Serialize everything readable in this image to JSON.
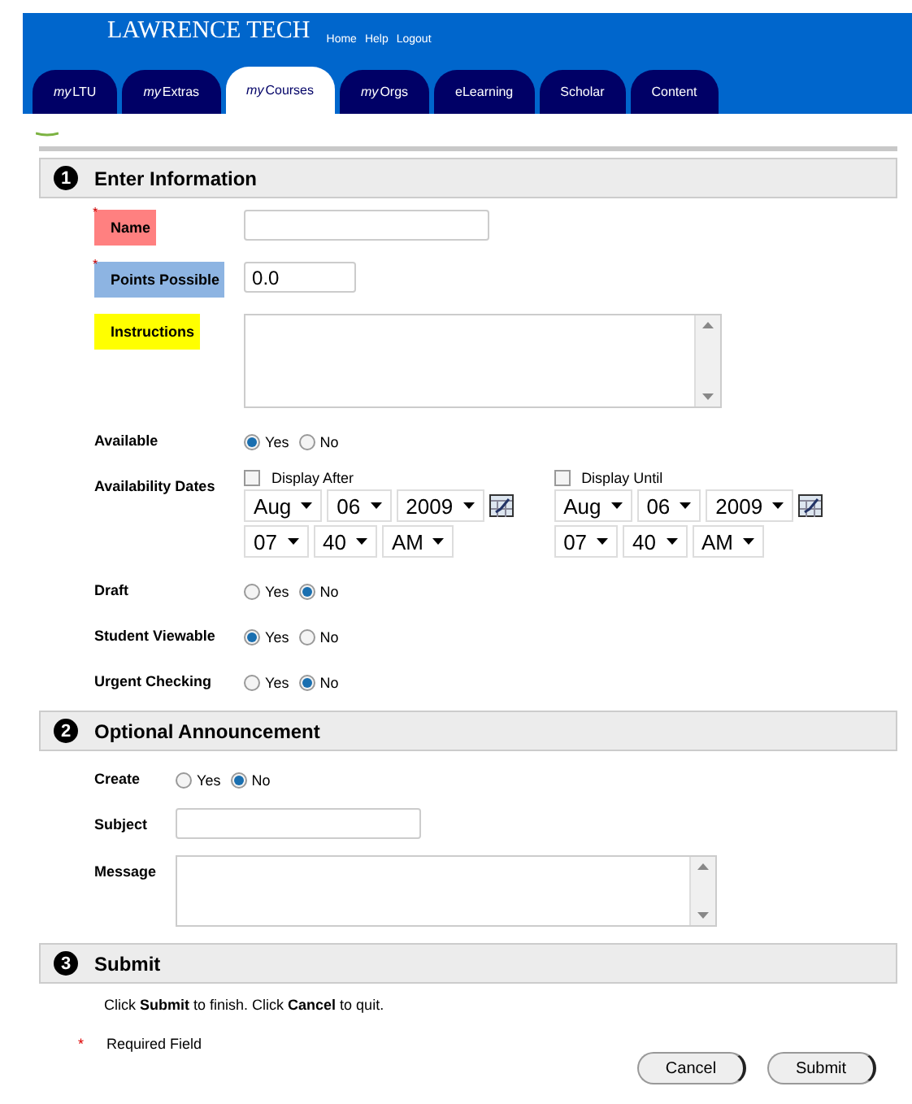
{
  "header": {
    "logo": "LAWRENCE TECH",
    "links": [
      "Home",
      "Help",
      "Logout"
    ],
    "tabs": [
      {
        "prefix": "my",
        "label": "LTU",
        "selected": false
      },
      {
        "prefix": "my",
        "label": "Extras",
        "selected": false
      },
      {
        "prefix": "my",
        "label": "Courses",
        "selected": true
      },
      {
        "prefix": "my",
        "label": "Orgs",
        "selected": false
      },
      {
        "label": "eLearning",
        "selected": false
      },
      {
        "label": "Scholar",
        "selected": false
      },
      {
        "label": "Content",
        "selected": false
      }
    ]
  },
  "sections": [
    {
      "number": "1",
      "title": "Enter Information",
      "fields": [
        {
          "kind": "text",
          "label": "Name",
          "mark": "*",
          "color": "#ff8080"
        },
        {
          "kind": "number",
          "label": "Points Possible",
          "mark": "*",
          "color": "#8db4e2",
          "value": "0.0"
        },
        {
          "kind": "textarea",
          "label": "Instructions",
          "color": "#ffff00"
        },
        {
          "kind": "radio",
          "label": "Available",
          "options": [
            {
              "label": "Yes",
              "selected": true
            },
            {
              "label": "No",
              "selected": false
            }
          ]
        },
        {
          "kind": "dates",
          "label": "Availability Dates",
          "groups": [
            {
              "label": "Display After",
              "checked": false,
              "date": [
                "Aug",
                "06",
                "2009"
              ],
              "time": [
                "07",
                "40",
                "AM"
              ]
            },
            {
              "label": "Display Until",
              "checked": false,
              "date": [
                "Aug",
                "06",
                "2009"
              ],
              "time": [
                "07",
                "40",
                "AM"
              ]
            }
          ]
        },
        {
          "kind": "radio",
          "label": "Draft",
          "options": [
            {
              "label": "Yes",
              "selected": false
            },
            {
              "label": "No",
              "selected": true
            }
          ]
        },
        {
          "kind": "radio",
          "label": "Student Viewable",
          "options": [
            {
              "label": "Yes",
              "selected": true
            },
            {
              "label": "No",
              "selected": false
            }
          ]
        },
        {
          "kind": "radio",
          "label": "Urgent Checking",
          "options": [
            {
              "label": "Yes",
              "selected": false
            },
            {
              "label": "No",
              "selected": true
            }
          ]
        }
      ]
    },
    {
      "number": "2",
      "title": "Optional Announcement",
      "fields": [
        {
          "kind": "radio",
          "label": "Create",
          "options": [
            {
              "label": "Yes",
              "selected": false
            },
            {
              "label": "No",
              "selected": true
            }
          ]
        },
        {
          "kind": "text",
          "label": "Subject"
        },
        {
          "kind": "textarea",
          "label": "Message"
        }
      ]
    },
    {
      "number": "3",
      "title": "Submit"
    }
  ],
  "submit_note": "Click **Submit** to finish. Click **Cancel** to quit.",
  "required_note": {
    "mark": "*",
    "text": "Required Field"
  },
  "buttons": [
    "Cancel",
    "Submit"
  ]
}
